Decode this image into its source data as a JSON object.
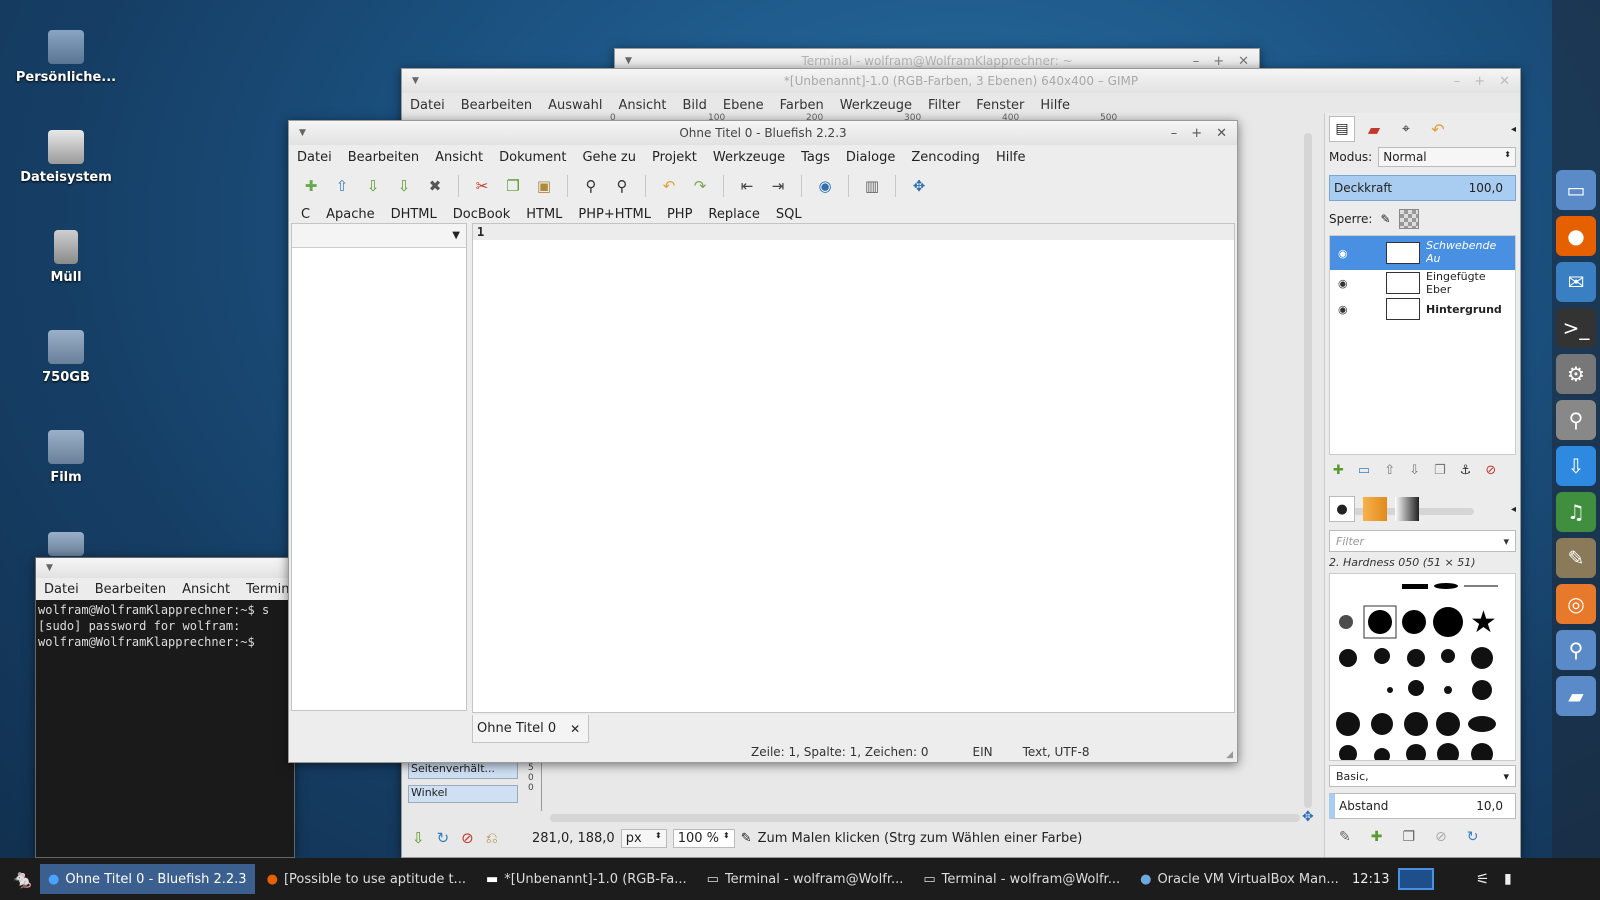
{
  "desktop": {
    "icons": [
      {
        "label": "Persönliche...",
        "icon": "home-folder-icon"
      },
      {
        "label": "Dateisystem",
        "icon": "drive-icon"
      },
      {
        "label": "Müll",
        "icon": "trash-icon"
      },
      {
        "label": "750GB",
        "icon": "usb-drive-icon"
      },
      {
        "label": "Film",
        "icon": "usb-drive-icon"
      }
    ]
  },
  "terminal_back": {
    "title": "Terminal - wolfram@WolframKlapprechner: ~"
  },
  "terminal": {
    "menu": [
      "Datei",
      "Bearbeiten",
      "Ansicht",
      "Terminal"
    ],
    "lines": [
      "wolfram@WolframKlapprechner:~$ s",
      "[sudo] password for wolfram:",
      "wolfram@WolframKlapprechner:~$ "
    ]
  },
  "gimp": {
    "title": "*[Unbenannt]-1.0 (RGB-Farben, 3 Ebenen) 640x400 – GIMP",
    "menu": [
      "Datei",
      "Bearbeiten",
      "Auswahl",
      "Ansicht",
      "Bild",
      "Ebene",
      "Farben",
      "Werkzeuge",
      "Filter",
      "Fenster",
      "Hilfe"
    ],
    "ruler": [
      "0",
      "100",
      "200",
      "300",
      "400",
      "500"
    ],
    "coords": "281,0, 188,0",
    "unit": "px",
    "zoom": "100 %",
    "status": "Zum Malen klicken (Strg zum Wählen einer Farbe)",
    "tool_options": [
      "Seitenverhält...",
      "Winkel"
    ],
    "layers": {
      "mode_label": "Modus:",
      "mode": "Normal",
      "opacity_label": "Deckkraft",
      "opacity": "100,0",
      "lock_label": "Sperre:",
      "items": [
        {
          "name": "Schwebende Au (Eingefügte Ebe",
          "selected": true
        },
        {
          "name": "Eingefügte Eber",
          "selected": false
        },
        {
          "name": "Hintergrund",
          "selected": false
        }
      ]
    },
    "brushes": {
      "filter": "Filter",
      "current": "2. Hardness 050 (51 × 51)",
      "preset": "Basic,",
      "spacing_label": "Abstand",
      "spacing": "10,0"
    }
  },
  "bluefish": {
    "title": "Ohne Titel 0 - Bluefish 2.2.3",
    "menu": [
      "Datei",
      "Bearbeiten",
      "Ansicht",
      "Dokument",
      "Gehe zu",
      "Projekt",
      "Werkzeuge",
      "Tags",
      "Dialoge",
      "Zencoding",
      "Hilfe"
    ],
    "toolbar": [
      {
        "icon": "new-file-icon",
        "glyph": "✚",
        "color": "#6aa84f"
      },
      {
        "icon": "open-file-icon",
        "glyph": "⇧",
        "color": "#3a7fc1"
      },
      {
        "icon": "save-icon",
        "glyph": "⇩",
        "color": "#5a9a2e"
      },
      {
        "icon": "save-as-icon",
        "glyph": "⇩",
        "color": "#5a9a2e"
      },
      {
        "icon": "close-file-icon",
        "glyph": "✖",
        "color": "#555555"
      },
      {
        "icon": "cut-icon",
        "glyph": "✂",
        "color": "#c0392b"
      },
      {
        "icon": "copy-icon",
        "glyph": "❐",
        "color": "#5a9a2e"
      },
      {
        "icon": "paste-icon",
        "glyph": "▣",
        "color": "#b08a3a"
      },
      {
        "icon": "find-icon",
        "glyph": "⚲",
        "color": "#333333"
      },
      {
        "icon": "find-replace-icon",
        "glyph": "⚲",
        "color": "#333333"
      },
      {
        "icon": "undo-icon",
        "glyph": "↶",
        "color": "#d9a43a"
      },
      {
        "icon": "redo-icon",
        "glyph": "↷",
        "color": "#7aa84f"
      },
      {
        "icon": "unindent-icon",
        "glyph": "⇤",
        "color": "#444444"
      },
      {
        "icon": "indent-icon",
        "glyph": "⇥",
        "color": "#444444"
      },
      {
        "icon": "preview-browser-icon",
        "glyph": "◉",
        "color": "#2d6fb0"
      },
      {
        "icon": "sidebar-toggle-icon",
        "glyph": "▥",
        "color": "#666666"
      },
      {
        "icon": "fullscreen-icon",
        "glyph": "✥",
        "color": "#2d6fb0"
      }
    ],
    "tabs": [
      "C",
      "Apache",
      "DHTML",
      "DocBook",
      "HTML",
      "PHP+HTML",
      "PHP",
      "Replace",
      "SQL"
    ],
    "line_number": "1",
    "doc_tab": "Ohne Titel 0",
    "status": {
      "position": "Zeile: 1, Spalte: 1, Zeichen: 0",
      "mode": "EIN",
      "encoding": "Text, UTF-8"
    }
  },
  "taskbar": {
    "tasks": [
      {
        "label": "Ohne Titel 0 - Bluefish 2.2.3",
        "icon": "bluefish-icon",
        "active": true
      },
      {
        "label": "[Possible to use aptitude t...",
        "icon": "firefox-icon",
        "active": false
      },
      {
        "label": "*[Unbenannt]-1.0 (RGB-Fa...",
        "icon": "gimp-icon",
        "active": false
      },
      {
        "label": "Terminal - wolfram@Wolfr...",
        "icon": "terminal-icon",
        "active": false
      },
      {
        "label": "Terminal - wolfram@Wolfr...",
        "icon": "terminal-icon",
        "active": false
      },
      {
        "label": "Oracle VM VirtualBox Man...",
        "icon": "virtualbox-icon",
        "active": false
      }
    ],
    "clock": "12:13"
  },
  "dock": {
    "icons": [
      "display-icon",
      "firefox-icon",
      "thunderbird-icon",
      "terminal-icon",
      "settings-icon",
      "search-icon",
      "download-icon",
      "music-icon",
      "gimp-icon",
      "blender-icon",
      "file-search-icon",
      "folder-icon"
    ]
  }
}
